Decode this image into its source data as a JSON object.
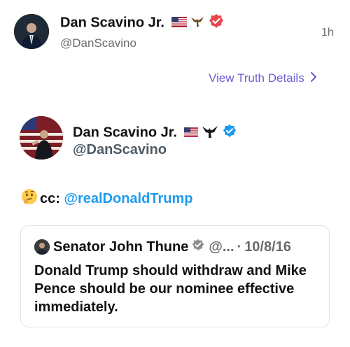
{
  "post": {
    "author_name": "Dan Scavino Jr.",
    "author_handle": "@DanScavino",
    "timestamp": "1h",
    "view_details_label": "View Truth Details",
    "chevron_icon": "chevron-right-icon"
  },
  "embedded": {
    "author_name": "Dan Scavino Jr.",
    "author_handle": "@DanScavino",
    "body_prefix": "cc: ",
    "mention": "@realDonaldTrump",
    "emoji_icon": "thinking-face-icon"
  },
  "quote": {
    "author_name": "Senator John Thune",
    "handle_trunc": "@...",
    "separator": "·",
    "date": "10/8/16",
    "text": "Donald Trump should withdraw and Mike Pence should be our nominee effective immediately."
  },
  "colors": {
    "accent": "#6a5fd6",
    "verified_red": "#e5484d",
    "verified_blue": "#1d9bf0",
    "mention_blue": "#1d9bf0",
    "muted_gray": "#6b6b6b"
  }
}
